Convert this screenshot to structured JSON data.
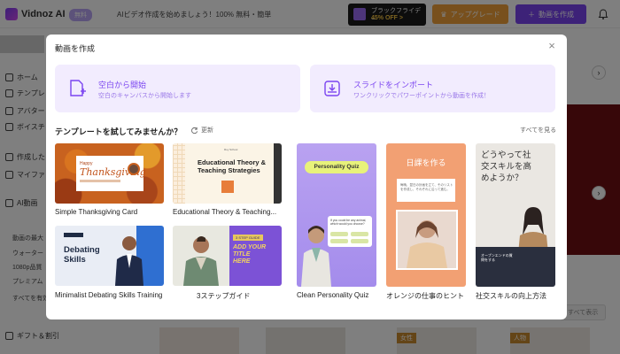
{
  "app": {
    "logo_text": "Vidnoz AI",
    "plan_badge": "無料",
    "promo_text": "AIビデオ作成を始めましょう！100% 無料・簡単",
    "black_friday_line1": "ブラックフライデー",
    "black_friday_line2": "45% OFF >",
    "upgrade_label": "アップグレード",
    "create_video_label": "動画を作成"
  },
  "sidebar": {
    "items": [
      {
        "label": "ホーム"
      },
      {
        "label": "テンプレ"
      },
      {
        "label": "アバター"
      },
      {
        "label": "ボイスチ"
      },
      {
        "label": "作成した"
      },
      {
        "label": "マイファ"
      },
      {
        "label": "AI動画"
      }
    ],
    "sections": [
      {
        "label": "動画の最大"
      },
      {
        "label": "ウォーター"
      },
      {
        "label": "1080p品質"
      },
      {
        "label": "プレミアム"
      },
      {
        "label": "すべてを有効"
      }
    ],
    "gift_label": "ギフト＆割引"
  },
  "background": {
    "see_all_label": "すべて表示",
    "cta_label": "すべて表示",
    "badge_a": "女性",
    "badge_b": "人物"
  },
  "modal": {
    "title": "動画を作成",
    "close_label": "×",
    "options": [
      {
        "title": "空白から開始",
        "subtitle": "空白のキャンバスから開始します"
      },
      {
        "title": "スライドをインポート",
        "subtitle": "ワンクリックでパワーポイントから動画を作成！"
      }
    ],
    "templates_heading": "テンプレートを試してみませんか？",
    "update_label": "更新",
    "see_all_label": "すべてを見る",
    "templates": [
      {
        "caption": "Simple Thanksgiving Card",
        "thumb_line1": "Happy",
        "thumb_line2": "Thanksgiving"
      },
      {
        "caption": "Educational Theory & Teaching...",
        "thumb_line1": "Educational Theory &",
        "thumb_line2": "Teaching Strategies",
        "thumb_small": "Roy School"
      },
      {
        "caption": "Minimalist Debating Skills Training",
        "thumb_line1": "Debating",
        "thumb_line2": "Skills"
      },
      {
        "caption": "3ステップガイド",
        "thumb_tag": "3 STEP GUIDE",
        "thumb_line1": "ADD YOUR TITLE",
        "thumb_line2": "HERE"
      },
      {
        "caption": "Clean Personality Quiz",
        "thumb_pill": "Personality Quiz",
        "thumb_question": "If you could be any animal, which would you choose?"
      },
      {
        "caption": "オレンジの仕事のヒント",
        "thumb_title": "日課を作る",
        "thumb_text": "毎晩、翌日の計画を立て、そのリストを作成し、それぞれに沿って進む。"
      },
      {
        "caption": "社交スキルの向上方法",
        "thumb_title": "どうやって社交スキルを高めようか？",
        "thumb_tag": "オープンエンドの質問をする"
      }
    ]
  },
  "colors": {
    "accent": "#7b45f0",
    "accent_light": "#f2ecfe",
    "upgrade": "#f0a13a",
    "overlay": "rgba(0,0,0,0.5)"
  }
}
